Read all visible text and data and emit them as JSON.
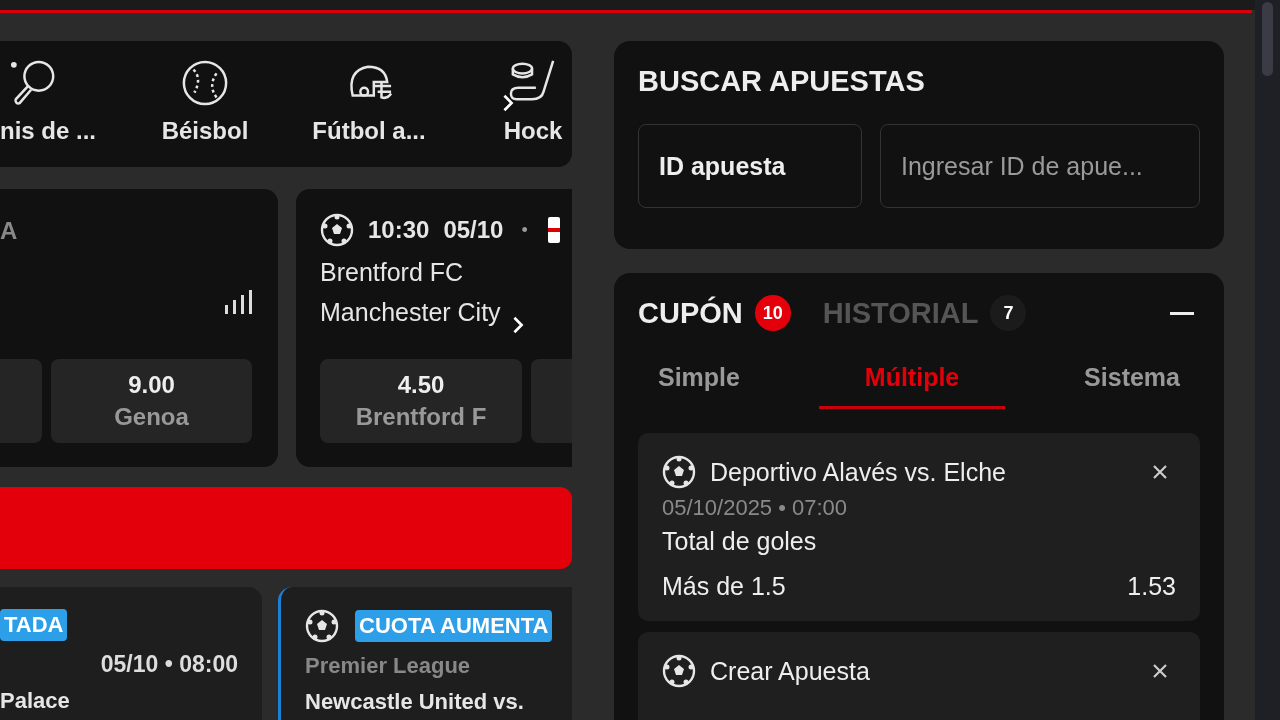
{
  "sports": [
    {
      "label": "nis de ..."
    },
    {
      "label": "Béisbol"
    },
    {
      "label": "Fútbol a..."
    },
    {
      "label": "Hock"
    }
  ],
  "featured_events": [
    {
      "kind": "stats",
      "header": "A",
      "odds": [
        {
          "odd": "9.00",
          "label": "Genoa"
        }
      ]
    },
    {
      "kind": "match",
      "time": "10:30",
      "date": "05/10",
      "separator": "•",
      "teams": [
        "Brentford FC",
        "Manchester City"
      ],
      "odds": [
        {
          "odd": "4.50",
          "label": "Brentford F"
        }
      ]
    }
  ],
  "boosted_events": [
    {
      "badge": "TADA",
      "datetime": "05/10 • 08:00",
      "teams": "Palace"
    },
    {
      "badge": "CUOTA AUMENTA",
      "league": "Premier League",
      "teams": "Newcastle United vs."
    }
  ],
  "bet_search": {
    "title": "BUSCAR APUESTAS",
    "type_label": "ID apuesta",
    "placeholder": "Ingresar ID de apue..."
  },
  "betslip": {
    "tabs": [
      {
        "label": "CUPÓN",
        "count": "10",
        "selected": true
      },
      {
        "label": "HISTORIAL",
        "count": "7",
        "selected": false
      }
    ],
    "modes": [
      {
        "label": "Simple",
        "selected": false
      },
      {
        "label": "Múltiple",
        "selected": true
      },
      {
        "label": "Sistema",
        "selected": false
      }
    ],
    "selections": [
      {
        "match": "Deportivo Alavés vs. Elche",
        "datetime": "05/10/2025 • 07:00",
        "market": "Total de goles",
        "pick": "Más de 1.5",
        "odd": "1.53"
      },
      {
        "match": "Crear Apuesta"
      }
    ]
  }
}
